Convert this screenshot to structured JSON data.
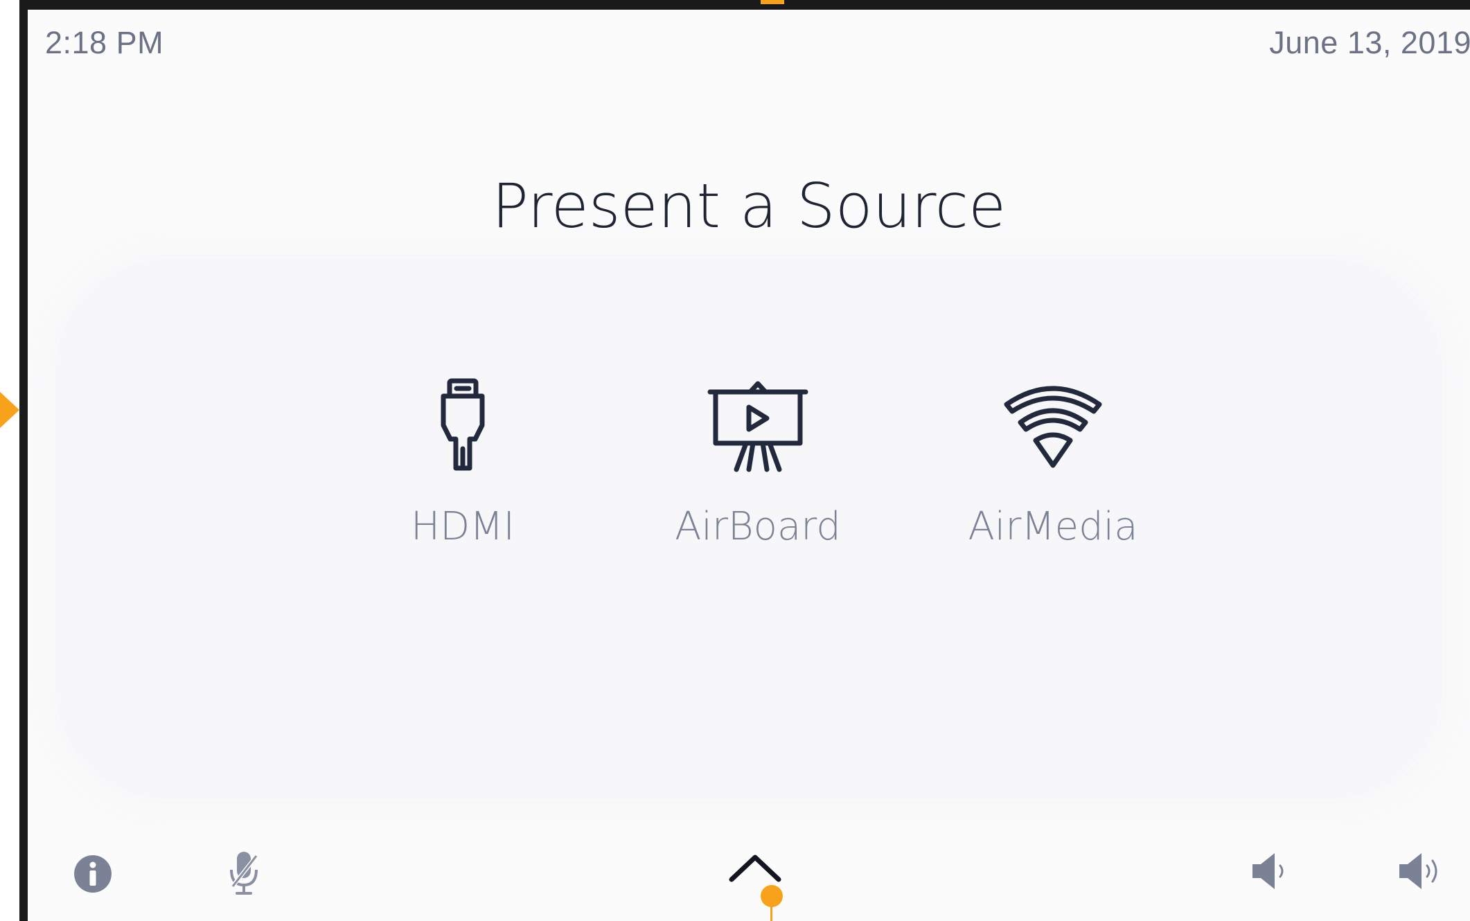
{
  "status_bar": {
    "time": "2:18 PM",
    "date": "June 13, 2019"
  },
  "main": {
    "title": "Present a Source",
    "sources": [
      {
        "label": "HDMI",
        "icon": "hdmi-plug-icon"
      },
      {
        "label": "AirBoard",
        "icon": "presentation-easel-icon"
      },
      {
        "label": "AirMedia",
        "icon": "wifi-icon"
      }
    ]
  },
  "bottom_bar": {
    "info_icon": "info-icon",
    "mic_icon": "microphone-muted-icon",
    "expand_icon": "chevron-up-icon",
    "volume_down_icon": "volume-down-icon",
    "volume_up_icon": "volume-up-icon"
  },
  "colors": {
    "text_primary": "#1f2433",
    "text_secondary": "#6b7286",
    "icon_dark": "#23293d",
    "icon_muted": "#8a90a2",
    "accent_marker": "#f7a21a",
    "bezel": "#1a1a1a",
    "screen_background": "#fbfbfc"
  }
}
